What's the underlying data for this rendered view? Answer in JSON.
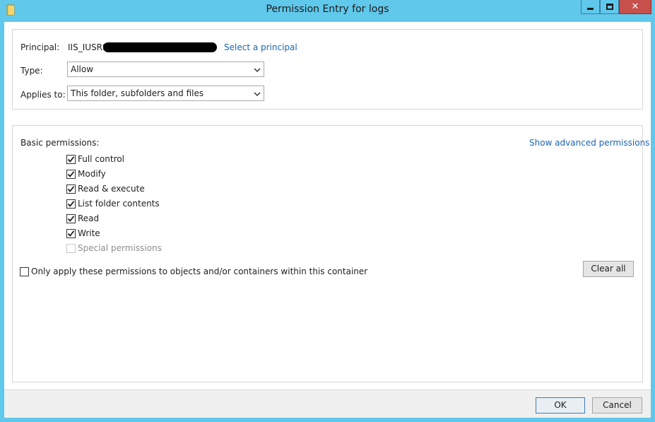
{
  "window": {
    "title": "Permission Entry for logs",
    "controls": {
      "minimize": "minimize",
      "maximize": "maximize",
      "close": "close"
    }
  },
  "principal": {
    "label": "Principal:",
    "value": "IIS_IUSRS",
    "select_link": "Select a principal"
  },
  "type": {
    "label": "Type:",
    "selected": "Allow"
  },
  "applies_to": {
    "label": "Applies to:",
    "selected": "This folder, subfolders and files"
  },
  "permissions": {
    "heading": "Basic permissions:",
    "advanced_link": "Show advanced permissions",
    "items": [
      {
        "label": "Full control",
        "checked": true,
        "enabled": true
      },
      {
        "label": "Modify",
        "checked": true,
        "enabled": true
      },
      {
        "label": "Read & execute",
        "checked": true,
        "enabled": true
      },
      {
        "label": "List folder contents",
        "checked": true,
        "enabled": true
      },
      {
        "label": "Read",
        "checked": true,
        "enabled": true
      },
      {
        "label": "Write",
        "checked": true,
        "enabled": true
      },
      {
        "label": "Special permissions",
        "checked": false,
        "enabled": false
      }
    ],
    "only_apply_label": "Only apply these permissions to objects and/or containers within this container",
    "only_apply_checked": false,
    "clear_all_label": "Clear all"
  },
  "footer": {
    "ok_label": "OK",
    "cancel_label": "Cancel"
  },
  "colors": {
    "frame": "#60c8eb",
    "close_button": "#c7504b",
    "link": "#1a66b4"
  }
}
